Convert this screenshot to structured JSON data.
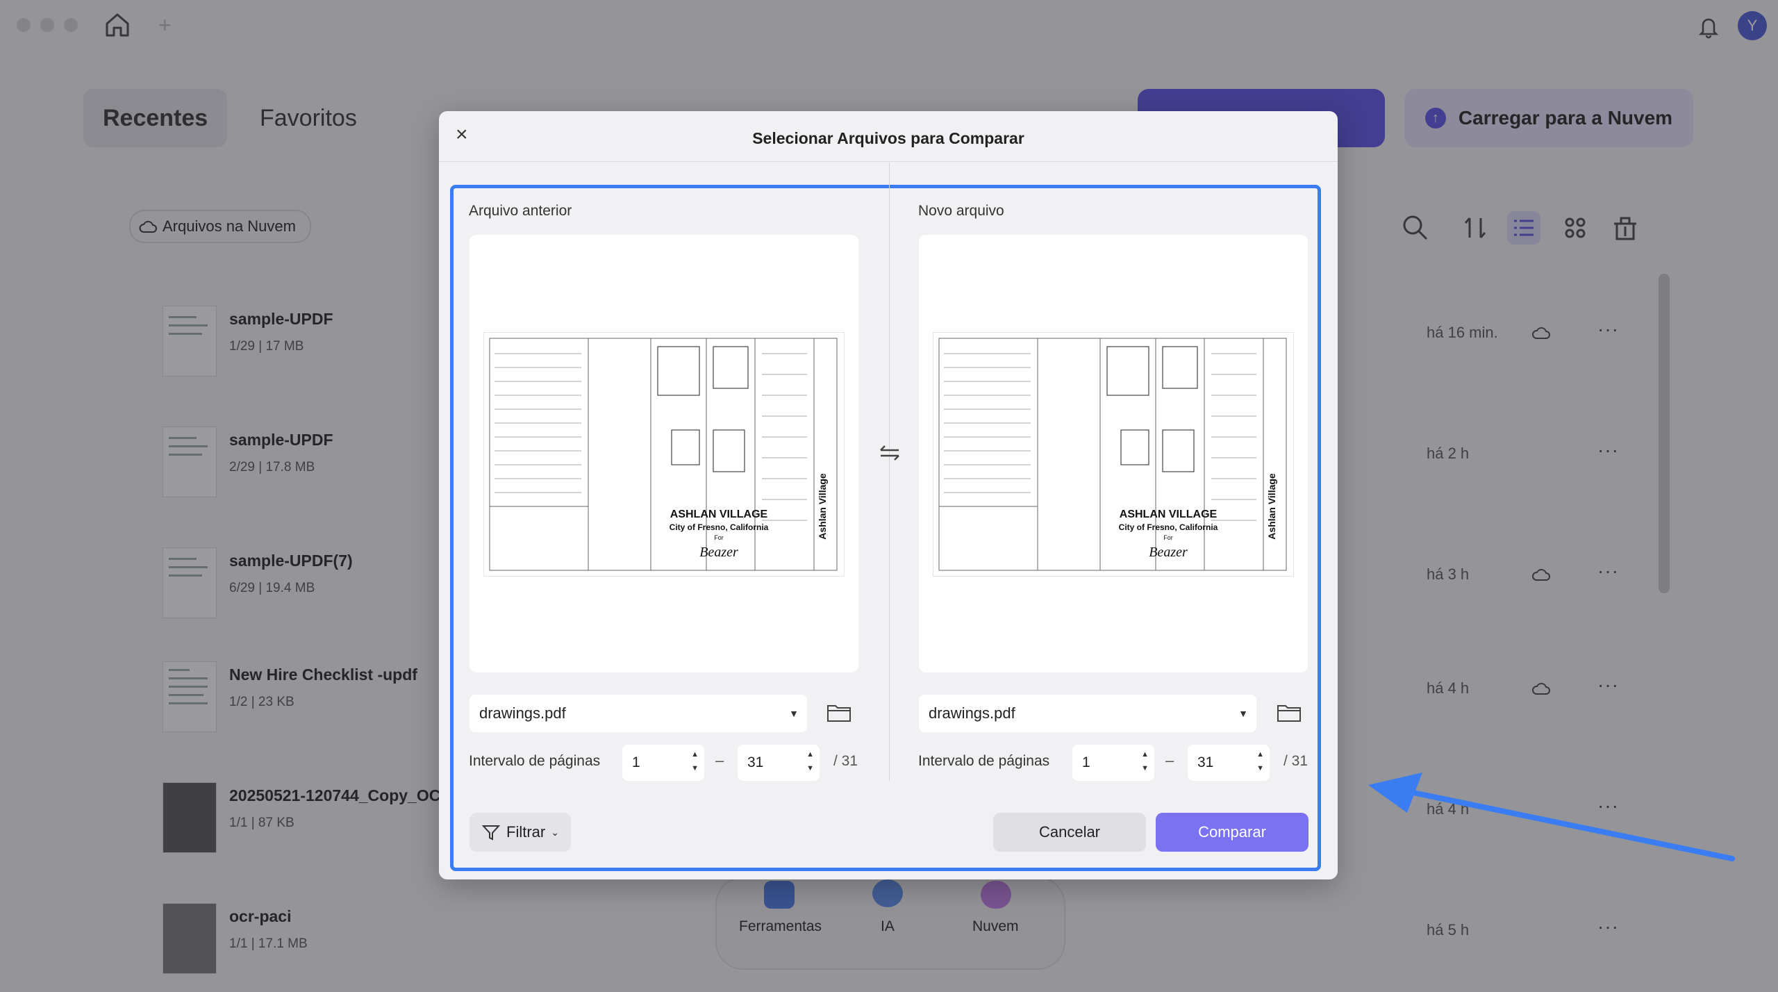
{
  "titlebar": {
    "avatar_initial": "Y"
  },
  "tabs": {
    "recent": "Recentes",
    "favorites": "Favoritos"
  },
  "header": {
    "upload_label": "Carregar para a Nuvem",
    "cloud_files": "Arquivos na Nuvem"
  },
  "files": [
    {
      "name": "sample-UPDF",
      "pages": "1/29",
      "size": "17 MB",
      "time": "há 16 min.",
      "cloud": true
    },
    {
      "name": "sample-UPDF",
      "pages": "2/29",
      "size": "17.8 MB",
      "time": "há 2 h",
      "cloud": false
    },
    {
      "name": "sample-UPDF(7)",
      "pages": "6/29",
      "size": "19.4 MB",
      "time": "há 3 h",
      "cloud": true
    },
    {
      "name": "New Hire Checklist -updf",
      "pages": "1/2",
      "size": "23 KB",
      "time": "há 4 h",
      "cloud": true
    },
    {
      "name": "20250521-120744_Copy_OC",
      "pages": "1/1",
      "size": "87 KB",
      "time": "há 4 h",
      "cloud": false
    },
    {
      "name": "ocr-paci",
      "pages": "1/1",
      "size": "17.1 MB",
      "time": "há 5 h",
      "cloud": false
    }
  ],
  "dock": {
    "tools": "Ferramentas",
    "ai": "IA",
    "cloud": "Nuvem"
  },
  "dialog": {
    "title": "Selecionar Arquivos para Comparar",
    "close": "×",
    "left": {
      "label": "Arquivo anterior",
      "file": "drawings.pdf",
      "range_label": "Intervalo de páginas",
      "from": "1",
      "to": "31",
      "total": "/ 31"
    },
    "right": {
      "label": "Novo arquivo",
      "file": "drawings.pdf",
      "range_label": "Intervalo de páginas",
      "from": "1",
      "to": "31",
      "total": "/ 31"
    },
    "filter": "Filtrar",
    "cancel": "Cancelar",
    "compare": "Comparar",
    "preview": {
      "title": "ASHLAN VILLAGE",
      "subtitle": "City of Fresno, California",
      "for": "For",
      "brand": "Beazer",
      "side": "Ashlan Village"
    }
  },
  "colors": {
    "accent": "#5b52e8",
    "highlight": "#3a7cf2",
    "compare_button": "#7b72f2"
  }
}
